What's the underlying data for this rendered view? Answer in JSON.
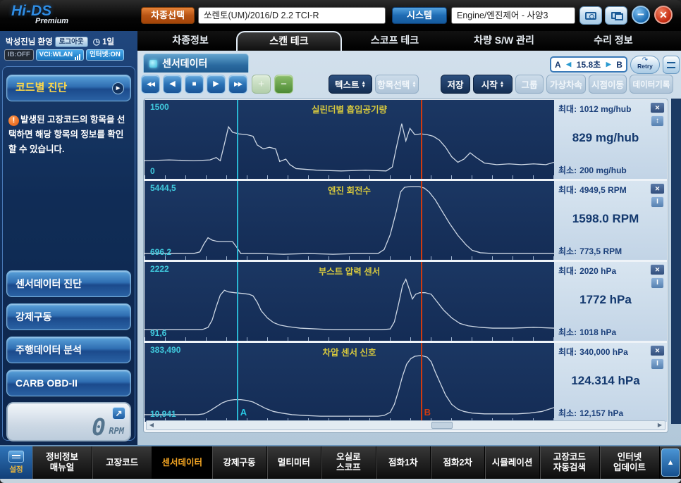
{
  "colors": {
    "accent_orange": "#c55a11",
    "accent_blue": "#2e75b6",
    "graph_bg": "#16305c",
    "graph_title_yellow": "#d6c83e",
    "scale_cyan": "#3fc8dc",
    "cursor_a_cyan": "#29b7d3",
    "cursor_b_red": "#d03a10",
    "value_navy": "#13386e",
    "active_item_orange": "#f5a623"
  },
  "icons": {
    "rewind": "◀◀",
    "prev": "◀",
    "stop": "■",
    "play": "▶",
    "forward": "▶▶",
    "plus": "+",
    "minus": "−",
    "close_x": "✕",
    "minimize": "−",
    "window_close": "✕",
    "up_arrow": "▲",
    "expand": "↗",
    "clock": "◷",
    "warning": "!",
    "a_left": "◀",
    "b_right": "▶",
    "retry_arrow": "↷",
    "dd_up": "▲",
    "dd_down": "▼",
    "code_arrow": "▶",
    "scroll_left": "◀",
    "scroll_right": "▶"
  },
  "header": {
    "logo_main": "Hi-DS",
    "logo_sub": "Premium",
    "vehicle_select_label": "차종선택",
    "vehicle_value": "쏘렌토(UM)/2016/D 2.2 TCI-R",
    "system_label": "시스템",
    "system_value": "Engine/엔진제어 - 사양3"
  },
  "tabs": [
    {
      "label": "차종정보"
    },
    {
      "label": "스캔 테크"
    },
    {
      "label": "스코프 테크"
    },
    {
      "label": "차량 S/W 관리"
    },
    {
      "label": "수리 정보"
    }
  ],
  "active_tab": "스캔 테크",
  "sidebar": {
    "welcome": "박성진님 환영",
    "logout_label": "로그아웃",
    "uptime": "1일",
    "badge_ib": "IB:OFF",
    "badge_vci": "VCI:WLAN",
    "badge_internet": "인터넷:ON",
    "code_diag_label": "코드별 진단",
    "notice": "발생된 고장코드의 항목을 선택하면 해당 항목의 정보를 확인 할 수 있습니다.",
    "menu": [
      {
        "label": "센서데이터 진단"
      },
      {
        "label": "강제구동"
      },
      {
        "label": "주행데이터 분석"
      },
      {
        "label": "CARB OBD-II"
      }
    ],
    "rpm_value": "0",
    "rpm_unit": "RPM"
  },
  "panel": {
    "title": "센서데이터",
    "ab": {
      "a": "A",
      "b": "B",
      "time": "15.8초"
    },
    "retry_label": "Retry",
    "controls": {
      "text": "텍스트",
      "item_select": "항목선택",
      "save": "저장",
      "start": "시작",
      "group": "그룹",
      "virtual_speed": "가상차속",
      "time_jump": "시점이동",
      "data_record": "데이터기록"
    }
  },
  "cursors": {
    "a_pos": 22.5,
    "b_pos": 67.4,
    "a_label": "A",
    "b_label": "B"
  },
  "graphs": [
    {
      "title": "실린더별 흡입공기량",
      "scale_max": "1500",
      "scale_min": "0",
      "max_label": "최대:",
      "max_value": "1012 mg/hub",
      "current": "829 mg/hub",
      "min_label": "최소:",
      "min_value": "200 mg/hub",
      "resize_icon": "↕",
      "curve": [
        [
          0,
          77
        ],
        [
          6,
          76
        ],
        [
          12,
          77
        ],
        [
          16,
          76
        ],
        [
          17.5,
          73
        ],
        [
          18.5,
          77
        ],
        [
          19.5,
          56
        ],
        [
          20.5,
          34
        ],
        [
          21.5,
          41
        ],
        [
          23,
          43
        ],
        [
          25,
          44
        ],
        [
          26.5,
          46
        ],
        [
          27.5,
          57
        ],
        [
          29,
          62
        ],
        [
          30.5,
          60
        ],
        [
          32,
          62
        ],
        [
          33,
          78
        ],
        [
          34.5,
          75
        ],
        [
          35.5,
          82
        ],
        [
          37,
          87
        ],
        [
          42,
          89
        ],
        [
          48,
          90
        ],
        [
          54,
          89
        ],
        [
          59,
          90
        ],
        [
          60.5,
          85
        ],
        [
          61.5,
          60
        ],
        [
          62.8,
          30
        ],
        [
          63.8,
          52
        ],
        [
          64.8,
          36
        ],
        [
          66,
          44
        ],
        [
          67.5,
          43
        ],
        [
          69,
          44
        ],
        [
          70.5,
          46
        ],
        [
          72,
          51
        ],
        [
          73.5,
          60
        ],
        [
          75,
          72
        ],
        [
          76.5,
          79
        ],
        [
          78,
          75
        ],
        [
          79.5,
          67
        ],
        [
          81,
          73
        ],
        [
          83,
          80
        ],
        [
          86,
          82
        ],
        [
          89,
          81
        ],
        [
          92,
          82
        ],
        [
          95,
          81
        ],
        [
          98,
          82
        ],
        [
          100,
          79
        ]
      ]
    },
    {
      "title": "엔진 회전수",
      "scale_max": "5444,5",
      "scale_min": "696,2",
      "max_label": "최대:",
      "max_value": "4949,5 RPM",
      "current": "1598.0 RPM",
      "min_label": "최소:",
      "min_value": "773,5 RPM",
      "resize_icon": "I",
      "curve": [
        [
          0,
          92
        ],
        [
          6,
          92
        ],
        [
          12,
          92
        ],
        [
          13.5,
          90
        ],
        [
          14.5,
          80
        ],
        [
          15.5,
          72
        ],
        [
          16.5,
          75
        ],
        [
          18,
          77
        ],
        [
          20,
          77
        ],
        [
          21.5,
          77
        ],
        [
          22.5,
          84
        ],
        [
          23.5,
          92
        ],
        [
          28,
          92
        ],
        [
          34,
          93
        ],
        [
          40,
          92
        ],
        [
          46,
          93
        ],
        [
          52,
          92
        ],
        [
          57,
          92
        ],
        [
          58.5,
          87
        ],
        [
          60,
          68
        ],
        [
          61.5,
          38
        ],
        [
          62.5,
          14
        ],
        [
          63.5,
          8
        ],
        [
          65,
          7
        ],
        [
          67,
          7
        ],
        [
          68.3,
          9
        ],
        [
          69.5,
          14
        ],
        [
          71,
          24
        ],
        [
          72.5,
          37
        ],
        [
          74.5,
          54
        ],
        [
          76.5,
          69
        ],
        [
          78.5,
          81
        ],
        [
          80,
          88
        ],
        [
          82,
          91
        ],
        [
          85,
          92
        ],
        [
          90,
          92
        ],
        [
          95,
          92
        ],
        [
          100,
          92
        ]
      ]
    },
    {
      "title": "부스트 압력 센서",
      "scale_max": "2222",
      "scale_min": "91,6",
      "max_label": "최대:",
      "max_value": "2020 hPa",
      "current": "1772 hPa",
      "min_label": "최소:",
      "min_value": "1018 hPa",
      "resize_icon": "I",
      "curve": [
        [
          0,
          86
        ],
        [
          6,
          86
        ],
        [
          12,
          86
        ],
        [
          14,
          86
        ],
        [
          15.5,
          83
        ],
        [
          16.5,
          74
        ],
        [
          17.5,
          57
        ],
        [
          18.5,
          42
        ],
        [
          19.5,
          36
        ],
        [
          20.5,
          38
        ],
        [
          22,
          39
        ],
        [
          24,
          40
        ],
        [
          25.5,
          41
        ],
        [
          26.5,
          43
        ],
        [
          27.5,
          51
        ],
        [
          28.5,
          62
        ],
        [
          30,
          71
        ],
        [
          31.5,
          77
        ],
        [
          33,
          80
        ],
        [
          35,
          82
        ],
        [
          38,
          84
        ],
        [
          42,
          85
        ],
        [
          46,
          86
        ],
        [
          52,
          86
        ],
        [
          58,
          86
        ],
        [
          60,
          85
        ],
        [
          61,
          76
        ],
        [
          62,
          54
        ],
        [
          63,
          30
        ],
        [
          63.8,
          22
        ],
        [
          64.6,
          34
        ],
        [
          65.4,
          47
        ],
        [
          66.2,
          41
        ],
        [
          67.2,
          39
        ],
        [
          68.5,
          39
        ],
        [
          70,
          41
        ],
        [
          71.5,
          51
        ],
        [
          73,
          61
        ],
        [
          75,
          71
        ],
        [
          77,
          78
        ],
        [
          79,
          81
        ],
        [
          82,
          83
        ],
        [
          85,
          84
        ],
        [
          90,
          84
        ],
        [
          95,
          83
        ],
        [
          100,
          84
        ]
      ]
    },
    {
      "title": "차압 센서 신호",
      "scale_max": "383,490",
      "scale_min": "10,941",
      "max_label": "최대:",
      "max_value": "340,000 hPa",
      "current": "124.314 hPa",
      "min_label": "최소:",
      "min_value": "12,157 hPa",
      "resize_icon": "I",
      "curve": [
        [
          0,
          91
        ],
        [
          5,
          91
        ],
        [
          10,
          91
        ],
        [
          13,
          91
        ],
        [
          14.5,
          90
        ],
        [
          16,
          86
        ],
        [
          17.5,
          81
        ],
        [
          19,
          76
        ],
        [
          20.5,
          73
        ],
        [
          22,
          72
        ],
        [
          23.5,
          72
        ],
        [
          25,
          73
        ],
        [
          26.5,
          75
        ],
        [
          28,
          79
        ],
        [
          29.5,
          83
        ],
        [
          31.5,
          87
        ],
        [
          33.5,
          89
        ],
        [
          36,
          91
        ],
        [
          39,
          92
        ],
        [
          43,
          93
        ],
        [
          48,
          93
        ],
        [
          53,
          93
        ],
        [
          57,
          93
        ],
        [
          58.5,
          92
        ],
        [
          60,
          88
        ],
        [
          61,
          78
        ],
        [
          62,
          61
        ],
        [
          63,
          42
        ],
        [
          64,
          27
        ],
        [
          65,
          20
        ],
        [
          66,
          17
        ],
        [
          67.5,
          16
        ],
        [
          69,
          18
        ],
        [
          70,
          24
        ],
        [
          71,
          37
        ],
        [
          72.2,
          51
        ],
        [
          73.5,
          66
        ],
        [
          75,
          78
        ],
        [
          76.5,
          84
        ],
        [
          78,
          87
        ],
        [
          80,
          89
        ],
        [
          83,
          90
        ],
        [
          87,
          90
        ],
        [
          91,
          90
        ],
        [
          94,
          89
        ],
        [
          97,
          87
        ],
        [
          100,
          82
        ]
      ]
    }
  ],
  "bottom_bar": {
    "settings_label": "설정",
    "items": [
      {
        "label": "정비정보\n매뉴얼"
      },
      {
        "label": "고장코드"
      },
      {
        "label": "센서데이터",
        "active": true
      },
      {
        "label": "강제구동"
      },
      {
        "label": "멀티미터"
      },
      {
        "label": "오실로\n스코프"
      },
      {
        "label": "점화1차"
      },
      {
        "label": "점화2차"
      },
      {
        "label": "시뮬레이션"
      },
      {
        "label": "고장코드\n자동검색"
      },
      {
        "label": "인터넷\n업데이트"
      }
    ]
  }
}
